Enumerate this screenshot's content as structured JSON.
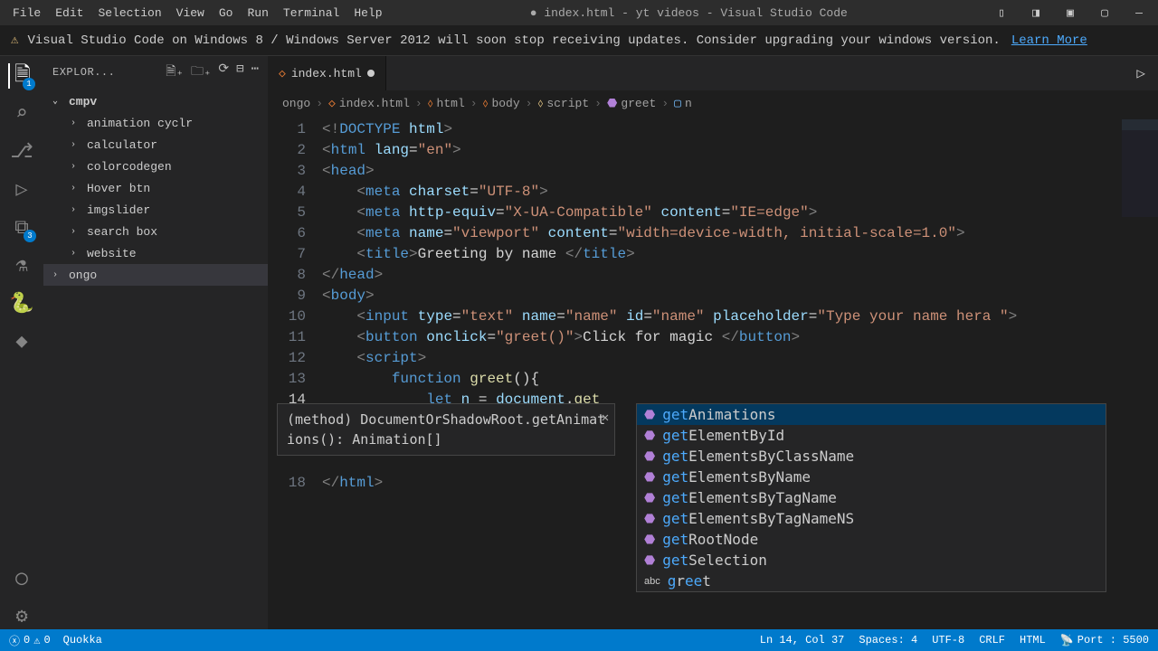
{
  "menubar": {
    "items": [
      "File",
      "Edit",
      "Selection",
      "View",
      "Go",
      "Run",
      "Terminal",
      "Help"
    ],
    "title": "● index.html - yt videos - Visual Studio Code"
  },
  "notification": {
    "text": "Visual Studio Code on Windows 8 / Windows Server 2012 will soon stop receiving updates. Consider upgrading your windows version.",
    "link": "Learn More"
  },
  "sidebar": {
    "header": "EXPLOR...",
    "root": "cmpv",
    "items": [
      {
        "label": "animation cyclr"
      },
      {
        "label": "calculator"
      },
      {
        "label": "colorcodegen"
      },
      {
        "label": "Hover btn"
      },
      {
        "label": "imgslider"
      },
      {
        "label": "search box"
      },
      {
        "label": "website"
      }
    ],
    "selected": "ongo"
  },
  "tab": {
    "name": "index.html"
  },
  "breadcrumb": {
    "folder": "ongo",
    "file": "index.html",
    "path": [
      "html",
      "body",
      "script",
      "greet",
      "n"
    ]
  },
  "code": {
    "lines": [
      {
        "n": 1
      },
      {
        "n": 2
      },
      {
        "n": 3
      },
      {
        "n": 4
      },
      {
        "n": 5
      },
      {
        "n": 6
      },
      {
        "n": 7
      },
      {
        "n": 8
      },
      {
        "n": 9
      },
      {
        "n": 10
      },
      {
        "n": 11
      },
      {
        "n": 12
      },
      {
        "n": 13
      },
      {
        "n": 14
      },
      {
        "n": 18
      }
    ],
    "title_text": "Greeting by name ",
    "placeholder": "Type your name hera ",
    "button_text": "Click for magic "
  },
  "param_hint": {
    "text1": "(method) DocumentOrShadowRoot.getAnimat",
    "text2": "ions(): Animation[]"
  },
  "autocomplete": {
    "items": [
      {
        "match": "get",
        "rest": "Animations",
        "selected": true,
        "icon": "method"
      },
      {
        "match": "get",
        "rest": "ElementById",
        "icon": "method"
      },
      {
        "match": "get",
        "rest": "ElementsByClassName",
        "icon": "method"
      },
      {
        "match": "get",
        "rest": "ElementsByName",
        "icon": "method"
      },
      {
        "match": "get",
        "rest": "ElementsByTagName",
        "icon": "method"
      },
      {
        "match": "get",
        "rest": "ElementsByTagNameNS",
        "icon": "method"
      },
      {
        "match": "get",
        "rest": "RootNode",
        "icon": "method"
      },
      {
        "match": "get",
        "rest": "Selection",
        "icon": "method"
      },
      {
        "match": "g",
        "mid": "r",
        "rest2": "ee",
        "tail": "t",
        "icon": "abc"
      }
    ]
  },
  "statusbar": {
    "errors": "0",
    "warnings": "0",
    "quokka": "Quokka",
    "pos": "Ln 14, Col 37",
    "spaces": "Spaces: 4",
    "encoding": "UTF-8",
    "eol": "CRLF",
    "lang": "HTML",
    "port": "Port : 5500"
  }
}
